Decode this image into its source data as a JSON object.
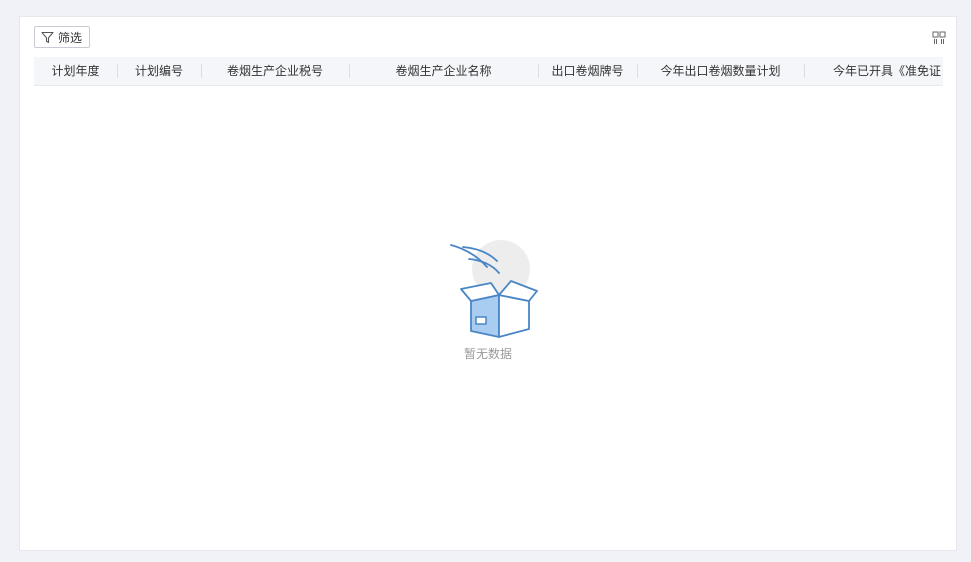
{
  "toolbar": {
    "filter_label": "筛选",
    "filter_icon": "funnel-icon",
    "column_settings_icon": "grid-icon"
  },
  "table": {
    "columns": [
      "计划年度",
      "计划编号",
      "卷烟生产企业税号",
      "卷烟生产企业名称",
      "出口卷烟牌号",
      "今年出口卷烟数量计划",
      "今年已开具《准免证"
    ],
    "rows": []
  },
  "empty_state": {
    "icon": "empty-box-icon",
    "text": "暂无数据"
  },
  "colors": {
    "accent_blue": "#4a86c6",
    "box_fill": "#a9cdf0",
    "background": "#f0f2f7"
  }
}
